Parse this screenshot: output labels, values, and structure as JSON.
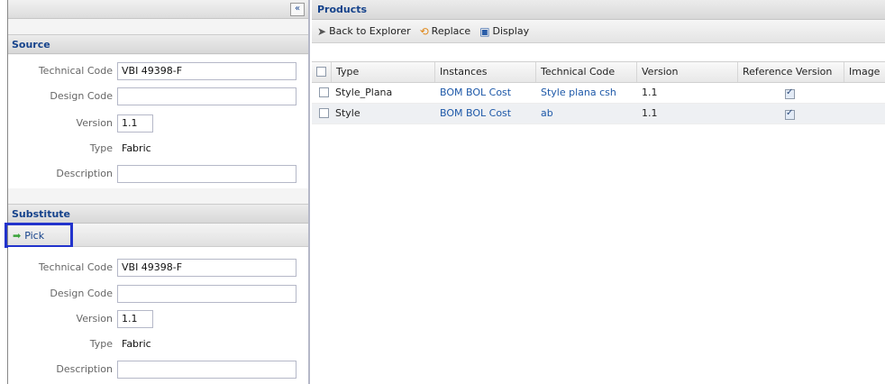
{
  "left_panel": {
    "collapse_symbol": "«",
    "source": {
      "title": "Source",
      "fields": [
        {
          "label": "Technical Code",
          "value": "VBI 49398-F"
        },
        {
          "label": "Design Code",
          "value": ""
        },
        {
          "label": "Version",
          "value": "1.1"
        },
        {
          "label": "Type",
          "value": "Fabric"
        },
        {
          "label": "Description",
          "value": ""
        }
      ]
    },
    "substitute": {
      "title": "Substitute",
      "pick_label": "Pick",
      "fields": [
        {
          "label": "Technical Code",
          "value": "VBI 49398-F"
        },
        {
          "label": "Design Code",
          "value": ""
        },
        {
          "label": "Version",
          "value": "1.1"
        },
        {
          "label": "Type",
          "value": "Fabric"
        },
        {
          "label": "Description",
          "value": ""
        }
      ]
    }
  },
  "products": {
    "title": "Products",
    "toolbar": {
      "back_label": "Back to Explorer",
      "replace_label": "Replace",
      "display_label": "Display"
    },
    "columns": [
      "Type",
      "Instances",
      "Technical Code",
      "Version",
      "Reference Version",
      "Image"
    ],
    "rows": [
      {
        "type": "Style_Plana",
        "instances": "BOM BOL Cost",
        "technical_code": "Style plana csh",
        "version": "1.1",
        "reference_version": true
      },
      {
        "type": "Style",
        "instances": "BOM BOL Cost",
        "technical_code": "ab",
        "version": "1.1",
        "reference_version": true
      }
    ]
  },
  "colors": {
    "accent": "#15428b",
    "highlight_border": "#2233cc",
    "link": "#1d58a8"
  },
  "icons": {
    "back": "back-arrow-icon",
    "replace": "replace-icon",
    "display": "display-icon",
    "pick": "green-arrow-icon"
  }
}
